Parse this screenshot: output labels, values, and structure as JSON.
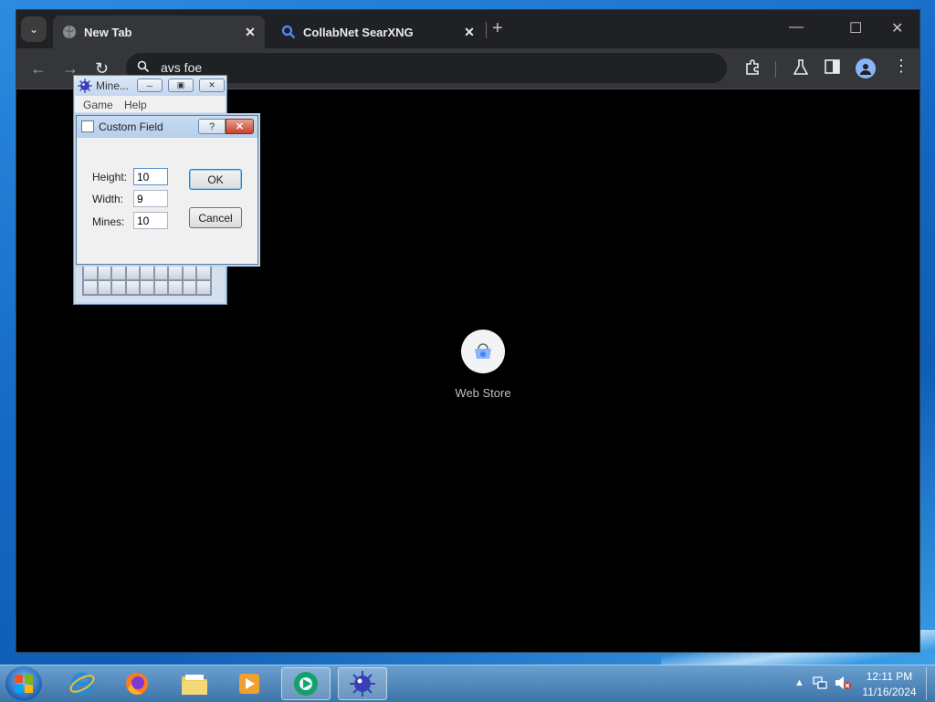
{
  "chrome": {
    "tabs": [
      {
        "title": "New Tab",
        "favicon": "globe-icon",
        "active": true
      },
      {
        "title": "CollabNet SearXNG",
        "favicon": "search-icon",
        "active": false
      }
    ],
    "omnibox_text": "avs foe",
    "shortcut_label": "Web Store"
  },
  "minesweeper": {
    "title": "Mine...",
    "menu": [
      "Game",
      "Help"
    ]
  },
  "dialog": {
    "title": "Custom Field",
    "fields": [
      {
        "label": "Height:",
        "value": "10"
      },
      {
        "label": "Width:",
        "value": "9"
      },
      {
        "label": "Mines:",
        "value": "10"
      }
    ],
    "ok_label": "OK",
    "cancel_label": "Cancel",
    "help_glyph": "?"
  },
  "taskbar": {
    "time": "12:11 PM",
    "date": "11/16/2024"
  },
  "colors": {
    "chrome_bg": "#202124",
    "toolbar_bg": "#35363a",
    "desktop": "#1b7fd1",
    "dialog_close": "#c5412b"
  }
}
